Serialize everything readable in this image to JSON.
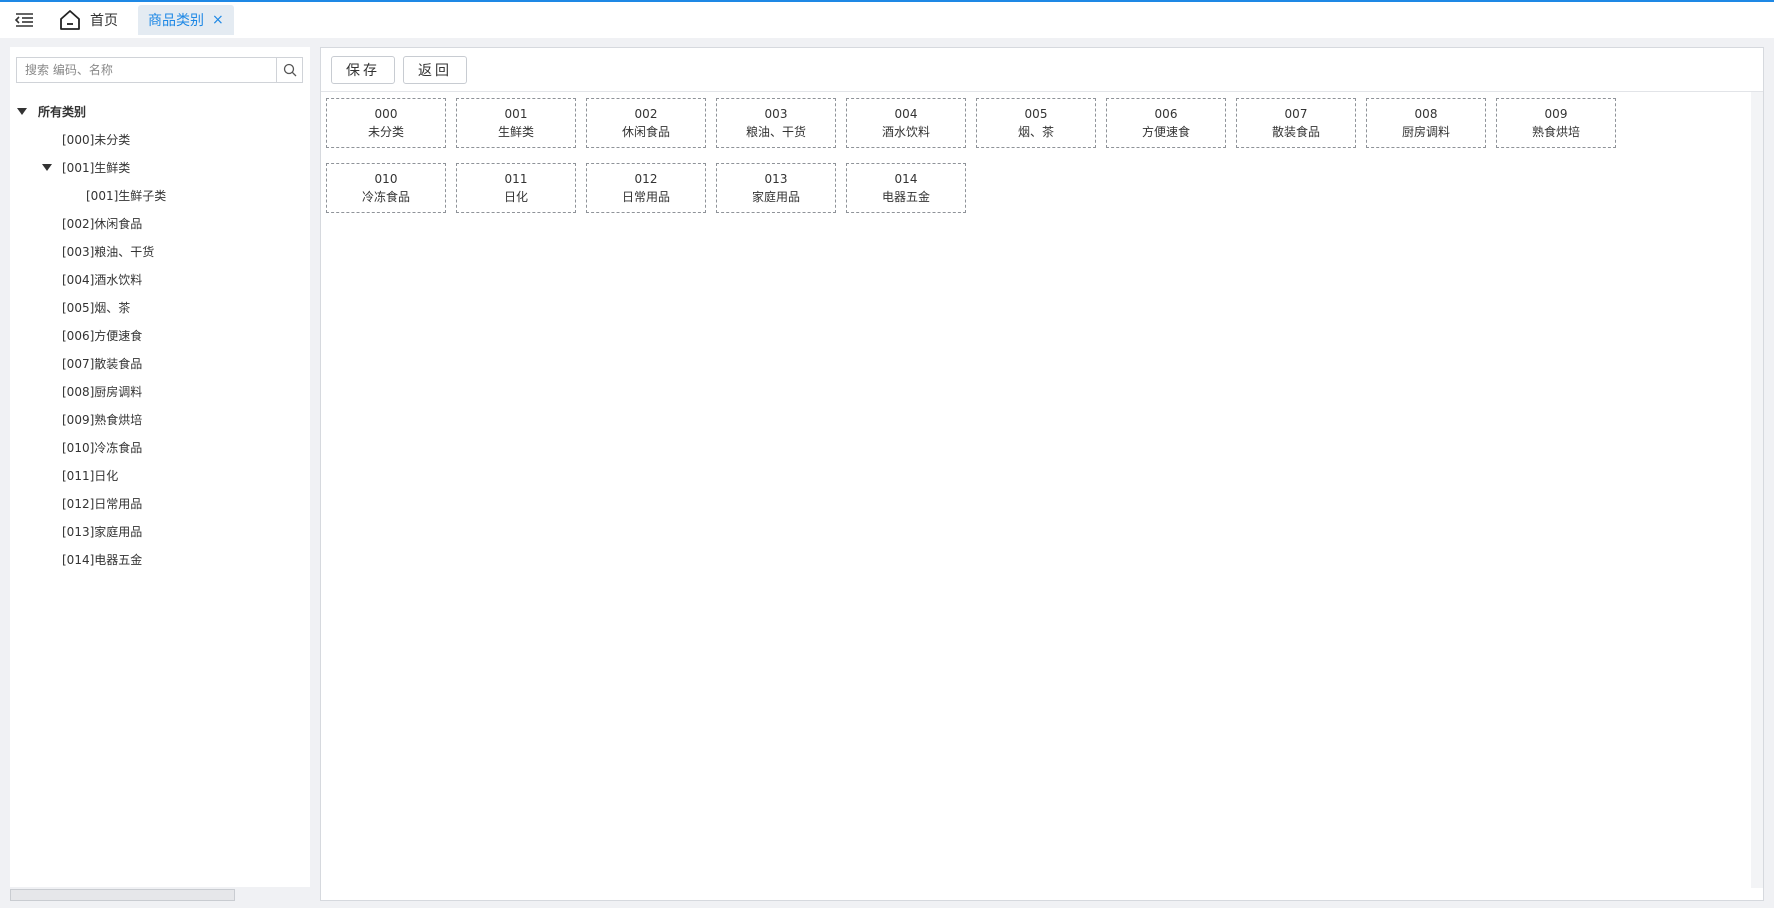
{
  "topbar": {
    "home_label": "首页",
    "active_tab_label": "商品类别",
    "close_glyph": "×",
    "accent_color": "#1e88e5"
  },
  "sidebar": {
    "search_placeholder": "搜索 编码、名称",
    "root_label": "所有类别",
    "items": [
      {
        "label": "[000]未分类",
        "level": 1,
        "expanded": false
      },
      {
        "label": "[001]生鲜类",
        "level": 1,
        "expanded": true
      },
      {
        "label": "[001]生鲜子类",
        "level": 2,
        "expanded": false
      },
      {
        "label": "[002]休闲食品",
        "level": 1,
        "expanded": false
      },
      {
        "label": "[003]粮油、干货",
        "level": 1,
        "expanded": false
      },
      {
        "label": "[004]酒水饮料",
        "level": 1,
        "expanded": false
      },
      {
        "label": "[005]烟、茶",
        "level": 1,
        "expanded": false
      },
      {
        "label": "[006]方便速食",
        "level": 1,
        "expanded": false
      },
      {
        "label": "[007]散装食品",
        "level": 1,
        "expanded": false
      },
      {
        "label": "[008]厨房调料",
        "level": 1,
        "expanded": false
      },
      {
        "label": "[009]熟食烘培",
        "level": 1,
        "expanded": false
      },
      {
        "label": "[010]冷冻食品",
        "level": 1,
        "expanded": false
      },
      {
        "label": "[011]日化",
        "level": 1,
        "expanded": false
      },
      {
        "label": "[012]日常用品",
        "level": 1,
        "expanded": false
      },
      {
        "label": "[013]家庭用品",
        "level": 1,
        "expanded": false
      },
      {
        "label": "[014]电器五金",
        "level": 1,
        "expanded": false
      }
    ]
  },
  "toolbar": {
    "save_label": "保存",
    "back_label": "返回"
  },
  "cards": [
    {
      "code": "000",
      "name": "未分类"
    },
    {
      "code": "001",
      "name": "生鲜类"
    },
    {
      "code": "002",
      "name": "休闲食品"
    },
    {
      "code": "003",
      "name": "粮油、干货"
    },
    {
      "code": "004",
      "name": "酒水饮料"
    },
    {
      "code": "005",
      "name": "烟、茶"
    },
    {
      "code": "006",
      "name": "方便速食"
    },
    {
      "code": "007",
      "name": "散装食品"
    },
    {
      "code": "008",
      "name": "厨房调料"
    },
    {
      "code": "009",
      "name": "熟食烘培"
    },
    {
      "code": "010",
      "name": "冷冻食品"
    },
    {
      "code": "011",
      "name": "日化"
    },
    {
      "code": "012",
      "name": "日常用品"
    },
    {
      "code": "013",
      "name": "家庭用品"
    },
    {
      "code": "014",
      "name": "电器五金"
    }
  ]
}
